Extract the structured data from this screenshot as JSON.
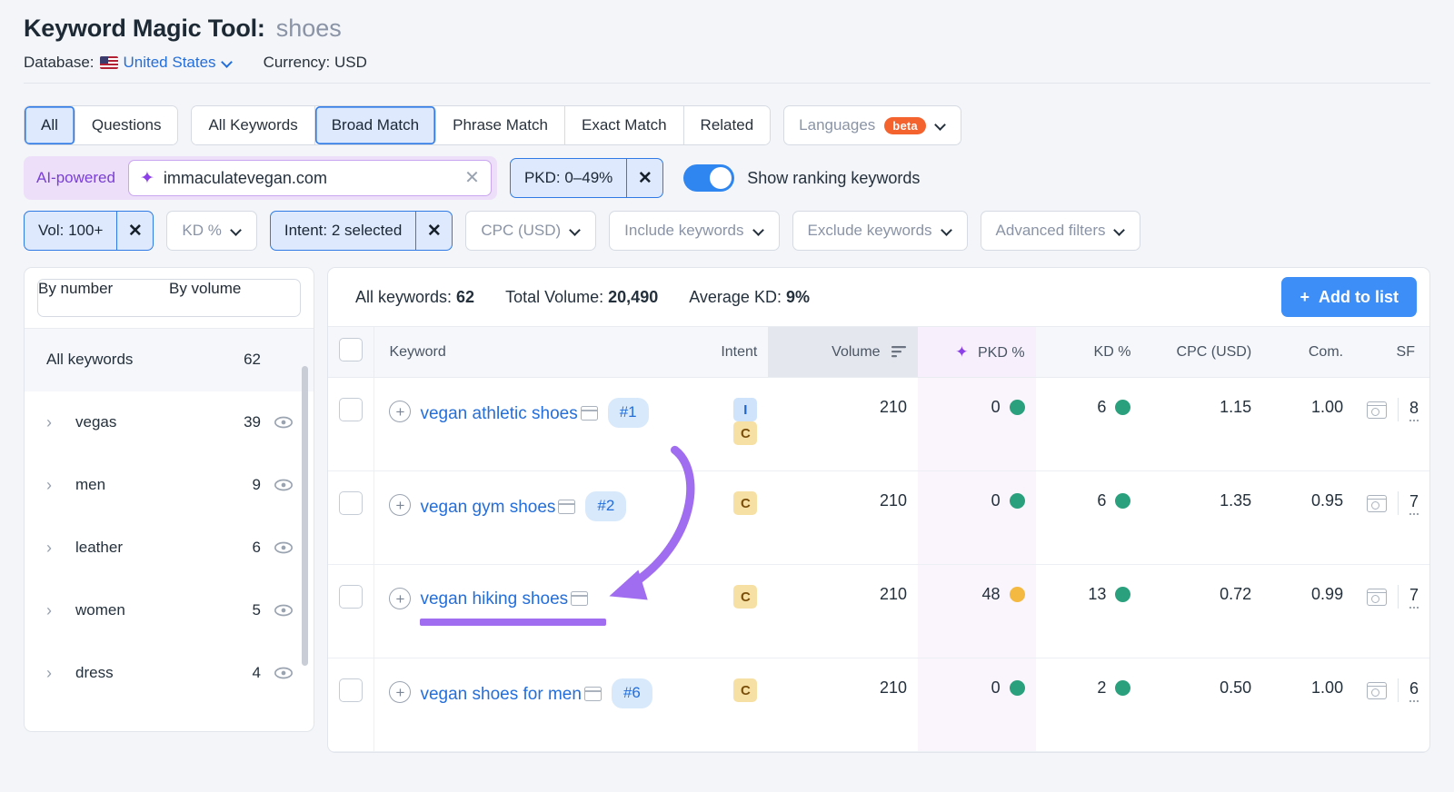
{
  "header": {
    "title_main": "Keyword Magic Tool:",
    "title_keyword": "shoes",
    "database_label": "Database:",
    "database_value": "United States",
    "currency_label": "Currency: USD"
  },
  "tabs": {
    "group1": [
      {
        "label": "All",
        "active": true
      },
      {
        "label": "Questions",
        "active": false
      }
    ],
    "group2": [
      {
        "label": "All Keywords",
        "active": false
      },
      {
        "label": "Broad Match",
        "active": true
      },
      {
        "label": "Phrase Match",
        "active": false
      },
      {
        "label": "Exact Match",
        "active": false
      },
      {
        "label": "Related",
        "active": false
      }
    ],
    "languages_label": "Languages",
    "languages_badge": "beta"
  },
  "filters": {
    "ai_label": "AI-powered",
    "domain_value": "immaculatevegan.com",
    "pkd_chip": "PKD: 0–49%",
    "toggle_label": "Show ranking keywords",
    "vol_chip": "Vol: 100+",
    "kd_label": "KD %",
    "intent_chip": "Intent: 2 selected",
    "cpc_label": "CPC (USD)",
    "include_label": "Include keywords",
    "exclude_label": "Exclude keywords",
    "advanced_label": "Advanced filters"
  },
  "sidebar": {
    "tabs": [
      {
        "label": "By number",
        "active": true
      },
      {
        "label": "By volume",
        "active": false
      }
    ],
    "all_row": {
      "label": "All keywords",
      "count": "62"
    },
    "items": [
      {
        "label": "vegas",
        "count": "39"
      },
      {
        "label": "men",
        "count": "9"
      },
      {
        "label": "leather",
        "count": "6"
      },
      {
        "label": "women",
        "count": "5"
      },
      {
        "label": "dress",
        "count": "4"
      }
    ]
  },
  "table": {
    "summary": {
      "all_keywords_label": "All keywords:",
      "all_keywords_value": "62",
      "total_volume_label": "Total Volume:",
      "total_volume_value": "20,490",
      "average_kd_label": "Average KD:",
      "average_kd_value": "9%"
    },
    "add_to_list_label": "Add to list",
    "columns": {
      "keyword": "Keyword",
      "intent": "Intent",
      "volume": "Volume",
      "pkd": "PKD %",
      "kd": "KD %",
      "cpc": "CPC (USD)",
      "com": "Com.",
      "sf": "SF"
    },
    "rows": [
      {
        "keyword": "vegan athletic shoes",
        "rank": "#1",
        "intents": [
          "I",
          "C"
        ],
        "volume": "210",
        "pkd": "0",
        "pkd_status": "green",
        "kd": "6",
        "kd_status": "green",
        "cpc": "1.15",
        "com": "1.00",
        "sf": "8",
        "highlighted": false
      },
      {
        "keyword": "vegan gym shoes",
        "rank": "#2",
        "intents": [
          "C"
        ],
        "volume": "210",
        "pkd": "0",
        "pkd_status": "green",
        "kd": "6",
        "kd_status": "green",
        "cpc": "1.35",
        "com": "0.95",
        "sf": "7",
        "highlighted": false
      },
      {
        "keyword": "vegan hiking shoes",
        "rank": "",
        "intents": [
          "C"
        ],
        "volume": "210",
        "pkd": "48",
        "pkd_status": "amber",
        "kd": "13",
        "kd_status": "green",
        "cpc": "0.72",
        "com": "0.99",
        "sf": "7",
        "highlighted": true
      },
      {
        "keyword": "vegan shoes for men",
        "rank": "#6",
        "intents": [
          "C"
        ],
        "volume": "210",
        "pkd": "0",
        "pkd_status": "green",
        "kd": "2",
        "kd_status": "green",
        "cpc": "0.50",
        "com": "1.00",
        "sf": "6",
        "highlighted": false
      }
    ]
  },
  "colors": {
    "accent_blue": "#246eda",
    "annotation_purple": "#a06df0",
    "toggle_on": "#2f86f0",
    "beta_orange": "#f4622e",
    "status_green": "#2aa07c",
    "status_amber": "#f4b940"
  }
}
